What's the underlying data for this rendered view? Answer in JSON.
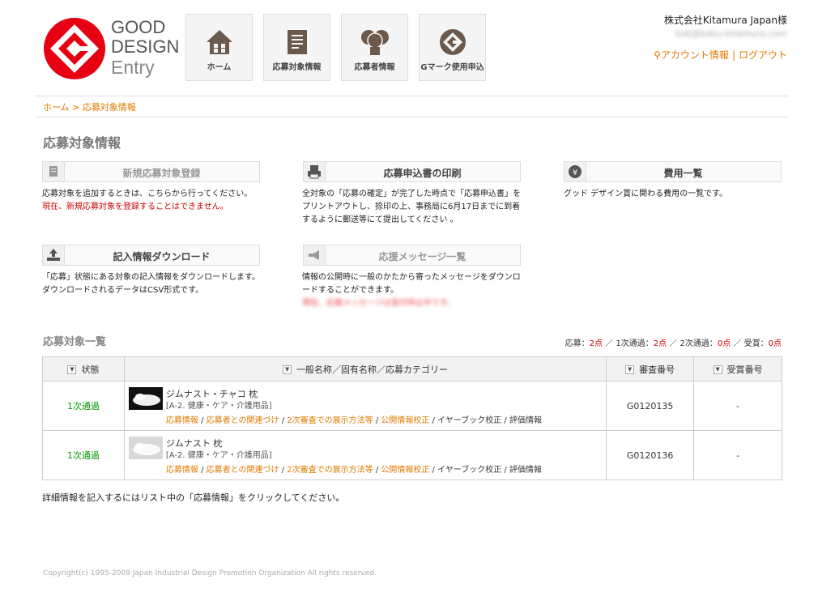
{
  "header": {
    "logo_good": "GOOD",
    "logo_design": "DESIGN",
    "logo_entry": "Entry",
    "nav": [
      {
        "label": "ホーム",
        "icon": "home-icon"
      },
      {
        "label": "応募対象情報",
        "icon": "document-icon"
      },
      {
        "label": "応募者情報",
        "icon": "users-icon"
      },
      {
        "label": "Gマーク使用申込",
        "icon": "g-mark-icon"
      }
    ],
    "company": "株式会社Kitamura Japan様",
    "email": "kob@kabu-kitamura.com",
    "account_label": "アカウント情報",
    "separator": "|",
    "logout_label": "ログアウト"
  },
  "breadcrumb": {
    "home": "ホーム",
    "sep": ">",
    "current": "応募対象情報"
  },
  "page_title": "応募対象情報",
  "sections": {
    "new": {
      "label": "新規応募対象登録",
      "desc1": "応募対象を追加するときは、こちらから行ってください。",
      "desc2": "現在、新規応募対象を登録することはできません。"
    },
    "print": {
      "label": "応募申込書の印刷",
      "desc": "全対象の「応募の確定」が完了した時点で「応募申込書」をプリントアウトし、捺印の上、事務局に6月17日までに到着するように郵送等にて提出してください 。"
    },
    "fees": {
      "label": "費用一覧",
      "desc": "グッド デザイン賞に関わる費用の一覧です。"
    },
    "download": {
      "label": "記入情報ダウンロード",
      "desc": "「応募」状態にある対象の記入情報をダウンロードします。ダウンロードされるデータはCSV形式です。"
    },
    "messages": {
      "label": "応援メッセージ一覧",
      "desc": "情報の公開時に一般のかたから寄ったメッセージをダウンロードすることができます。",
      "note": "現在、応援メッセージは受付停止中です。"
    }
  },
  "list": {
    "title": "応募対象一覧",
    "counts": {
      "apply_label": "応募：",
      "apply_val": "2点",
      "sep": "／",
      "pass1_label": "1次通過：",
      "pass1_val": "2点",
      "pass2_label": "2次通過：",
      "pass2_val": "0点",
      "award_label": "受賞：",
      "award_val": "0点"
    },
    "headers": {
      "status": "状態",
      "name": "一般名称／固有名称／応募カテゴリー",
      "review_no": "審査番号",
      "award_no": "受賞番号",
      "sort_icon": "▼"
    },
    "rows": [
      {
        "status": "1次通過",
        "name": "ジムナスト・チャコ 枕",
        "category": "[A-2. 健康・ケア・介護用品]",
        "review_no": "G0120135",
        "award_no": "-",
        "thumb": "dark"
      },
      {
        "status": "1次通過",
        "name": "ジムナスト 枕",
        "category": "[A-2. 健康・ケア・介護用品]",
        "review_no": "G0120136",
        "award_no": "-",
        "thumb": "light"
      }
    ],
    "links": {
      "info": "応募情報",
      "sep": " / ",
      "relation": "応募者との関連づけ",
      "display": "2次審査での展示方法等",
      "public": "公開情報校正",
      "yearbook": "イヤーブック校正",
      "eval": "評価情報"
    }
  },
  "note": "詳細情報を記入するにはリスト中の「応募情報」をクリックしてください。",
  "copyright": "Copyright(c) 1995-2009 Japan Industrial Design Promotion Organization All rights reserved.",
  "colors": {
    "accent": "#e07a00",
    "brand_red": "#e60012",
    "pass_green": "#009900"
  }
}
